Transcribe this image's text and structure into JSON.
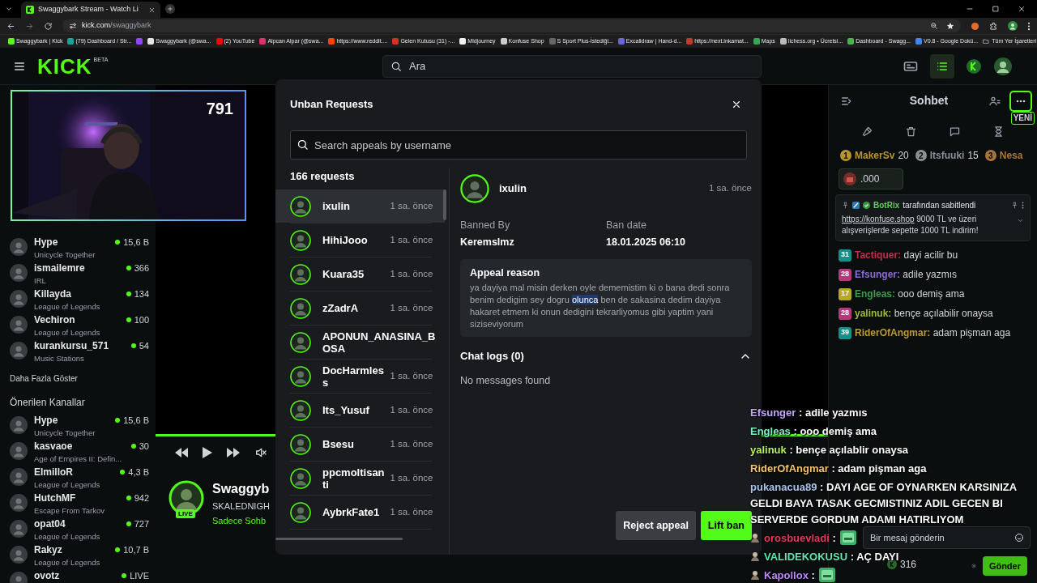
{
  "browser": {
    "tab_title": "Swaggybark Stream - Watch Li",
    "url_host": "kick.com",
    "url_path": "/swaggybark",
    "all_bookmarks": "Tüm Yer İşaretleri",
    "bookmarks": [
      {
        "kind": "link",
        "title": "Swaggybark | Kick",
        "color": "#53fc18"
      },
      {
        "kind": "link",
        "title": "(79) Dashboard / Str...",
        "color": "#1aa39a"
      },
      {
        "kind": "icon",
        "color": "#9146ff"
      },
      {
        "kind": "link",
        "title": "Swaggybark (@swa...",
        "color": "#e5e5e5"
      },
      {
        "kind": "link",
        "title": "(2) YouTube",
        "color": "#ff0000"
      },
      {
        "kind": "link",
        "title": "Alpcan Alpar (@swa...",
        "color": "#e1306c"
      },
      {
        "kind": "link",
        "title": "https://www.reddit....",
        "color": "#ff4500"
      },
      {
        "kind": "link",
        "title": "Gelen Kutusu (31) -...",
        "color": "#d93025"
      },
      {
        "kind": "link",
        "title": "Midjourney",
        "color": "#f2f2f2"
      },
      {
        "kind": "link",
        "title": "Konfuse Shop",
        "color": "#cccccc"
      },
      {
        "kind": "link",
        "title": "S Sport Plus-İstediği...",
        "color": "#666666"
      },
      {
        "kind": "link",
        "title": "Excalidraw | Hand-d...",
        "color": "#6965db"
      },
      {
        "kind": "link",
        "title": "https://next.inkamat...",
        "color": "#c0392b"
      },
      {
        "kind": "link",
        "title": "Maps",
        "color": "#34a853"
      },
      {
        "kind": "link",
        "title": "lichess.org • Ücretsi...",
        "color": "#bbbbbb"
      },
      {
        "kind": "link",
        "title": "Dashboard - Swagg...",
        "color": "#4caf50"
      },
      {
        "kind": "link",
        "title": "V0.8 - Google Dokü...",
        "color": "#4285f4"
      }
    ]
  },
  "header": {
    "logo": "KICK",
    "logo_badge": "BETA",
    "search_placeholder": "Ara"
  },
  "webcam": {
    "viewer_count": "791"
  },
  "sidebar": {
    "followed": [
      {
        "name": "Hype",
        "category": "Unicycle Together",
        "viewers": "15,6 B"
      },
      {
        "name": "ismailemre",
        "category": "IRL",
        "viewers": "366"
      },
      {
        "name": "Killayda",
        "category": "League of Legends",
        "viewers": "134"
      },
      {
        "name": "Vechiron",
        "category": "League of Legends",
        "viewers": "100"
      },
      {
        "name": "kurankursu_571",
        "category": "Music Stations",
        "viewers": "54"
      }
    ],
    "show_more": "Daha Fazla Göster",
    "recommended_title": "Önerilen Kanallar",
    "recommended": [
      {
        "name": "Hype",
        "category": "Unicycle Together",
        "viewers": "15,6 B"
      },
      {
        "name": "kasvaoe",
        "category": "Age of Empires II: Defin...",
        "viewers": "30"
      },
      {
        "name": "ElmilloR",
        "category": "League of Legends",
        "viewers": "4,3 B"
      },
      {
        "name": "HutchMF",
        "category": "Escape From Tarkov",
        "viewers": "942"
      },
      {
        "name": "opat04",
        "category": "League of Legends",
        "viewers": "727"
      },
      {
        "name": "Rakyz",
        "category": "League of Legends",
        "viewers": "10,7 B"
      },
      {
        "name": "ovotz",
        "viewers": "LIVE"
      }
    ]
  },
  "player": {
    "level": 1,
    "streamer": "Swaggyb",
    "title": "SKALEDNIGH",
    "tagline": "Sadece Sohb",
    "live_badge": "LIVE"
  },
  "chat": {
    "title": "Sohbet",
    "new_label": "YENİ",
    "gifters": [
      {
        "rank": "1",
        "name": "MakerSv",
        "count": "20",
        "color": "#b8962a"
      },
      {
        "rank": "2",
        "name": "Itsfuuki",
        "count": "15",
        "color": "#8a9096"
      },
      {
        "rank": "3",
        "name": "Nesa",
        "color": "#a8763a"
      }
    ],
    "goal": ".000",
    "pinned": {
      "by": "BotRix",
      "label": "tarafından sabitlendi",
      "link": "https://konfuse.shop",
      "text": " 9000 TL ve üzeri alışverişlerde sepette 1000 TL indirim!"
    },
    "messages": [
      {
        "badge": {
          "level": "31",
          "color": "#1a8f88"
        },
        "user": "Tactiquer:",
        "color": "#c0304a",
        "text": " dayi acilir bu"
      },
      {
        "badge": {
          "level": "28",
          "color": "#b03a7a"
        },
        "user": "Efsunger:",
        "color": "#8a6fd0",
        "text": " adile yazmıs"
      },
      {
        "badge": {
          "level": "17",
          "color": "#b8a82a"
        },
        "user": "Engleas:",
        "color": "#3f9a4a",
        "text": " ooo demiş ama"
      },
      {
        "badge": {
          "level": "28",
          "color": "#b03a7a"
        },
        "user": "yalinuk:",
        "color": "#9cbc3a",
        "text": " bençe açılabilir onaysa"
      },
      {
        "badge": {
          "level": "39",
          "color": "#1a8f88"
        },
        "user": "RiderOfAngmar:",
        "color": "#b89a3a",
        "text": " adam pişman aga"
      }
    ],
    "input_placeholder": "Bir mesaj gönderin",
    "points": "316",
    "send": "Gönder"
  },
  "stream_chat": [
    {
      "kind": "text",
      "user": "Efsunger",
      "color": "#c3a6f7",
      "sep": " : ",
      "text": "adile yazmıs"
    },
    {
      "kind": "text",
      "user": "Engleas",
      "color": "#79f2c0",
      "sep": " : ",
      "text": "ooo demiş ama"
    },
    {
      "kind": "text",
      "user": "yalinuk",
      "color": "#b6f25a",
      "sep": " : ",
      "text": "bençe açılablir onaysa"
    },
    {
      "kind": "text",
      "user": "RiderOfAngmar",
      "color": "#f2c46d",
      "sep": " : ",
      "text": "adam pişman aga"
    },
    {
      "kind": "text",
      "user": "pukanacua89",
      "color": "#a9c5ee",
      "sep": " : ",
      "text": "DAYI AGE OF OYNARKEN KARSINIZA GELDI BAYA TASAK GECMISTINIZ ADIL GECEN BI SERVERDE GORDUM ADAMI HATIRLIYOM"
    },
    {
      "kind": "emote",
      "user": "orosbuevladi",
      "color": "#e8395b",
      "sep": " : ",
      "avatar": true
    },
    {
      "kind": "text",
      "user": "VALIDEKOKUSU",
      "color": "#5ee8b5",
      "sep": " : ",
      "text": "AÇ DAYI",
      "avatar": true
    },
    {
      "kind": "emote",
      "user": "Kapollox",
      "color": "#b98af3",
      "sep": " : ",
      "avatar": true
    }
  ],
  "unban_modal": {
    "title": "Unban Requests",
    "search_placeholder": "Search appeals by username",
    "count": "166 requests",
    "requests": [
      {
        "name": "ixulin",
        "time": "1 sa. önce",
        "selected": true
      },
      {
        "name": "HihiJooo",
        "time": "1 sa. önce",
        "selected": false
      },
      {
        "name": "Kuara35",
        "time": "1 sa. önce",
        "selected": false
      },
      {
        "name": "zZadrA",
        "time": "1 sa. önce",
        "selected": false
      },
      {
        "name": "APONUN_ANASINA_BOSA",
        "selected": false
      },
      {
        "name": "DocHarmless",
        "time": "1 sa. önce",
        "selected": false
      },
      {
        "name": "Its_Yusuf",
        "time": "1 sa. önce",
        "selected": false
      },
      {
        "name": "Bsesu",
        "time": "1 sa. önce",
        "selected": false
      },
      {
        "name": "ppcmoltisanti",
        "time": "1 sa. önce",
        "selected": false
      },
      {
        "name": "AybrkFate1",
        "time": "1 sa. önce",
        "selected": false
      }
    ],
    "detail": {
      "name": "ixulin",
      "time": "1 sa. önce",
      "banned_by_label": "Banned By",
      "banned_by": "Keremslmz",
      "ban_date_label": "Ban date",
      "ban_date": "18.01.2025 06:10",
      "reason_title": "Appeal reason",
      "reason": [
        {
          "text": "ya dayiya mal misin derken oyle dememistim ki o bana dedi sonra benim dedigim sey dogru ",
          "selected": false
        },
        {
          "text": "olunca",
          "selected": true
        },
        {
          "text": " ben de sakasina dedim dayiya hakaret etmem ki onun dedigini tekrarliyomus gibi yaptim yani siziseviyorum",
          "selected": false
        }
      ],
      "chat_logs_title": "Chat logs (0)",
      "chat_logs_expanded": true,
      "chat_logs_empty": "No messages found"
    },
    "buttons": [
      {
        "label": "Reject appeal",
        "kind": "secondary"
      },
      {
        "label": "Lift ban",
        "kind": "primary"
      }
    ]
  }
}
